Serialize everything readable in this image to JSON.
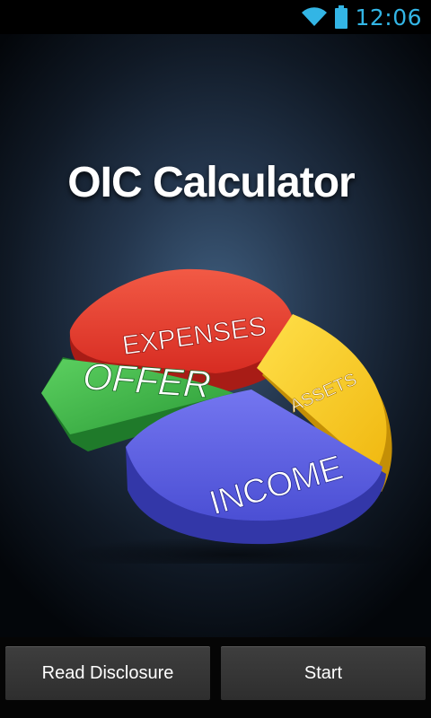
{
  "status_bar": {
    "time": "12:06",
    "icons": [
      "wifi-icon",
      "battery-icon"
    ],
    "accent_color": "#33b5e5"
  },
  "splash": {
    "title": "OIC Calculator",
    "chart_labels": {
      "expenses": "EXPENSES",
      "offer": "OFFER",
      "assets": "ASSETS",
      "income": "INCOME"
    },
    "colors": {
      "expenses": "#e63a2e",
      "offer": "#3db34a",
      "assets": "#f5c518",
      "income": "#5a5ee0"
    }
  },
  "buttons": {
    "read_disclosure": "Read Disclosure",
    "start": "Start"
  }
}
